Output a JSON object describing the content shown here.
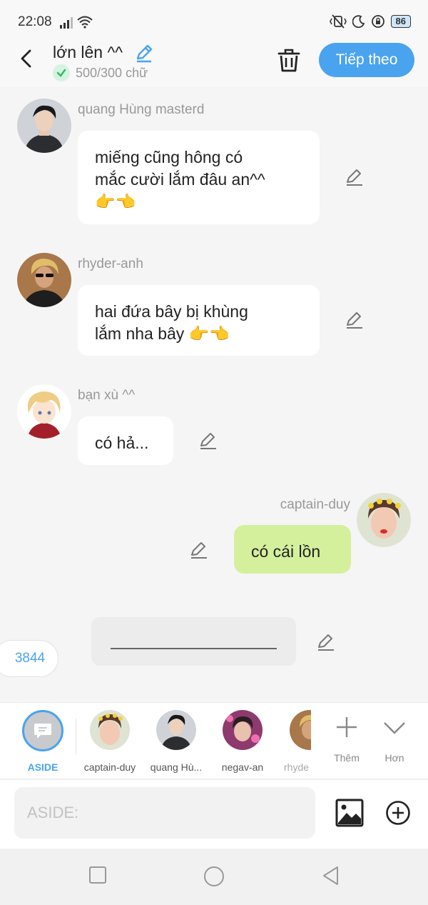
{
  "status_bar": {
    "time": "22:08",
    "battery": "86"
  },
  "header": {
    "title": "lớn lên ^^",
    "char_count": "500/300 chữ",
    "next_label": "Tiếp theo"
  },
  "messages": [
    {
      "sender": "quang Hùng masterd",
      "lines": [
        "miếng cũng hông có",
        "mắc cười lắm đâu an^^",
        "👉👈"
      ]
    },
    {
      "sender": "rhyder-anh",
      "lines": [
        "hai đứa bây bị khùng",
        "lắm nha bây 👉👈"
      ]
    },
    {
      "sender": "bạn xù ^^",
      "lines": [
        "có hả..."
      ]
    },
    {
      "sender": "captain-duy",
      "lines": [
        "có cái lồn"
      ]
    }
  ],
  "counter_badge": "3844",
  "characters": [
    {
      "label": "ASIDE"
    },
    {
      "label": "captain-duy"
    },
    {
      "label": "quang Hù..."
    },
    {
      "label": "negav-an"
    },
    {
      "label": "rhyde"
    }
  ],
  "tools": {
    "add_label": "Thêm",
    "more_label": "Hơn"
  },
  "input": {
    "placeholder": "ASIDE:"
  },
  "colors": {
    "accent": "#4aa3ef",
    "my_bubble": "#d5f09c",
    "background": "#f5f5f5"
  }
}
